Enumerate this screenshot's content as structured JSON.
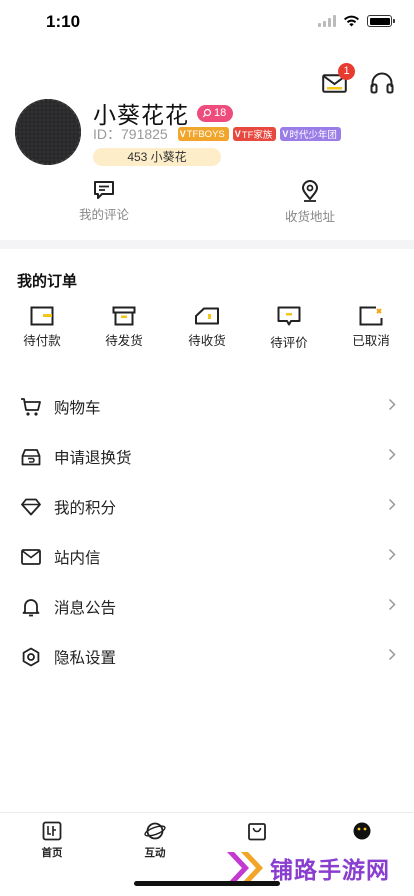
{
  "status_bar": {
    "time": "1:10"
  },
  "header": {
    "mail_badge_count": "1",
    "mail_icon": "mail-icon",
    "service_icon": "headphones-icon"
  },
  "profile": {
    "name": "小葵花花",
    "level": "18",
    "id_text": "ID：791825",
    "tags": [
      "TFBOYS",
      "TF家族",
      "时代少年团"
    ],
    "points_text": "453 小葵花"
  },
  "quick_links": [
    {
      "label": "我的评论",
      "icon": "comment-icon"
    },
    {
      "label": "收货地址",
      "icon": "location-pin-icon"
    }
  ],
  "orders": {
    "title": "我的订单",
    "items": [
      {
        "label": "待付款",
        "icon": "wallet-icon"
      },
      {
        "label": "待发货",
        "icon": "box-icon"
      },
      {
        "label": "待收货",
        "icon": "truck-icon"
      },
      {
        "label": "待评价",
        "icon": "review-icon"
      },
      {
        "label": "已取消",
        "icon": "cancelled-icon"
      }
    ]
  },
  "menu": [
    {
      "label": "购物车",
      "icon": "cart-icon"
    },
    {
      "label": "申请退换货",
      "icon": "return-icon"
    },
    {
      "label": "我的积分",
      "icon": "diamond-icon"
    },
    {
      "label": "站内信",
      "icon": "envelope-icon"
    },
    {
      "label": "消息公告",
      "icon": "bell-icon"
    },
    {
      "label": "隐私设置",
      "icon": "settings-icon"
    }
  ],
  "tabs": [
    {
      "label": "首页",
      "icon": "home-icon"
    },
    {
      "label": "互动",
      "icon": "planet-icon"
    },
    {
      "label": "",
      "icon": "shopping-bag-icon"
    },
    {
      "label": "",
      "icon": "profile-face-icon"
    }
  ],
  "watermark": {
    "text": "铺路手游网"
  },
  "colors": {
    "accent_yellow": "#f5c518",
    "badge_red": "#e83a2f",
    "level_pink": "#ef4c7e",
    "points_bg": "#fdeec9"
  }
}
